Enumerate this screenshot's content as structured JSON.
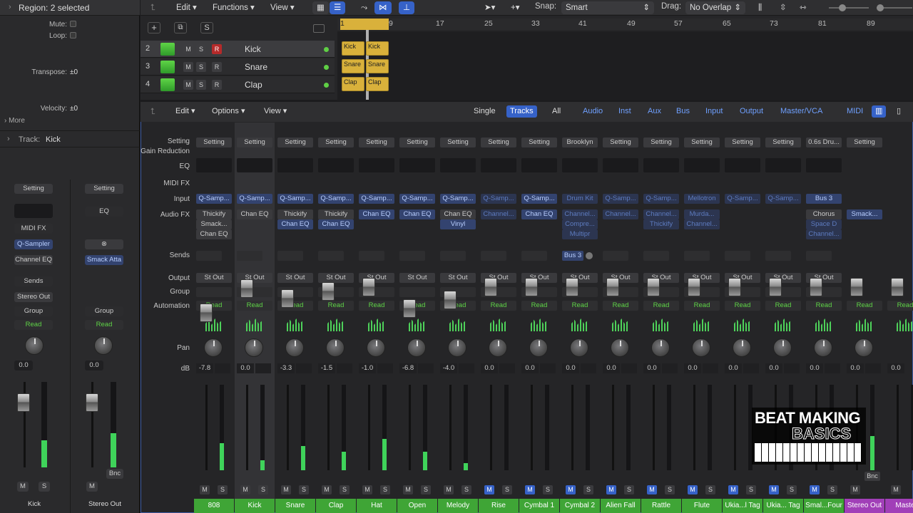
{
  "inspector": {
    "region_label": "Region: 2 selected",
    "rows": [
      {
        "label": "Mute:",
        "value": ""
      },
      {
        "label": "Loop:",
        "value": ""
      },
      {
        "label": "Transpose:",
        "value": "±0"
      },
      {
        "label": "Velocity:",
        "value": "±0"
      }
    ],
    "more": "More",
    "track_label": "Track:",
    "track_name": "Kick",
    "left": {
      "setting": "Setting",
      "midi_fx": "MIDI FX",
      "input": "Q-Sampler",
      "fx": "Channel EQ",
      "sends": "Sends",
      "output": "Stereo Out",
      "group": "Group",
      "auto": "Read",
      "db": "0.0",
      "m": "M",
      "s": "S",
      "name": "Kick"
    },
    "right": {
      "setting": "Setting",
      "eq": "EQ",
      "fx": "Smack Atta",
      "group": "Group",
      "auto": "Read",
      "db": "0.0",
      "m": "M",
      "bnc": "Bnc",
      "name": "Stereo Out"
    }
  },
  "toolbar": {
    "edit": "Edit",
    "functions": "Functions",
    "view": "View",
    "snap_label": "Snap:",
    "snap": "Smart",
    "drag_label": "Drag:",
    "drag": "No Overlap"
  },
  "ruler": [
    {
      "n": "1"
    },
    {
      "n": "9"
    },
    {
      "n": "17"
    },
    {
      "n": "25"
    },
    {
      "n": "33"
    },
    {
      "n": "41"
    },
    {
      "n": "49"
    },
    {
      "n": "57"
    },
    {
      "n": "65"
    },
    {
      "n": "73"
    },
    {
      "n": "81"
    },
    {
      "n": "89"
    }
  ],
  "tracks": [
    {
      "num": "2",
      "name": "Kick",
      "r": "R",
      "region": "Kick"
    },
    {
      "num": "3",
      "name": "Snare",
      "r": "R",
      "region": "Snare"
    },
    {
      "num": "4",
      "name": "Clap",
      "r": "R",
      "region": "Clap"
    }
  ],
  "track_buttons": {
    "m": "M",
    "s": "S"
  },
  "mixer_bar": {
    "edit": "Edit",
    "options": "Options",
    "view": "View",
    "single": "Single",
    "tracks": "Tracks",
    "all": "All",
    "audio": "Audio",
    "inst": "Inst",
    "aux": "Aux",
    "bus": "Bus",
    "input": "Input",
    "output": "Output",
    "master": "Master/VCA",
    "midi": "MIDI"
  },
  "row_labels": {
    "setting": "Setting",
    "gain": "Gain Reduction",
    "eq": "EQ",
    "midifx": "MIDI FX",
    "input": "Input",
    "audiofx": "Audio FX",
    "sends": "Sends",
    "output": "Output",
    "group": "Group",
    "automation": "Automation",
    "pan": "Pan",
    "db": "dB"
  },
  "strips": [
    {
      "name": "808",
      "setting": "Setting",
      "input": "Q-Samp...",
      "fx": [
        "Thickify",
        "Smack...",
        "Chan EQ"
      ],
      "out": "St Out",
      "auto": "Read",
      "db": "-7.8",
      "m": "M",
      "s": "S"
    },
    {
      "name": "Kick",
      "setting": "Setting",
      "input": "Q-Samp...",
      "fx": [
        "Chan EQ"
      ],
      "out": "St Out",
      "auto": "Read",
      "db": "0.0",
      "m": "M",
      "s": "S"
    },
    {
      "name": "Snare",
      "setting": "Setting",
      "input": "Q-Samp...",
      "fx": [
        "Thickify",
        "Chan EQ"
      ],
      "out": "St Out",
      "auto": "Read",
      "db": "-3.3",
      "m": "M",
      "s": "S"
    },
    {
      "name": "Clap",
      "setting": "Setting",
      "input": "Q-Samp...",
      "fx": [
        "Thickify",
        "Chan EQ"
      ],
      "out": "St Out",
      "auto": "Read",
      "db": "-1.5",
      "m": "M",
      "s": "S"
    },
    {
      "name": "Hat",
      "setting": "Setting",
      "input": "Q-Samp...",
      "fx": [
        "Chan EQ"
      ],
      "out": "St Out",
      "auto": "Read",
      "db": "-1.0",
      "m": "M",
      "s": "S"
    },
    {
      "name": "Open",
      "setting": "Setting",
      "input": "Q-Samp...",
      "fx": [
        "Chan EQ"
      ],
      "out": "St Out",
      "auto": "Read",
      "db": "-6.8",
      "m": "M",
      "s": "S"
    },
    {
      "name": "Melody",
      "setting": "Setting",
      "input": "Q-Samp...",
      "fx": [
        "Chan EQ",
        "Vinyl"
      ],
      "out": "St Out",
      "auto": "Read",
      "db": "-4.0",
      "m": "M",
      "s": "S"
    },
    {
      "name": "Rise",
      "setting": "Setting",
      "input": "Q-Samp...",
      "fx": [
        "Channel..."
      ],
      "out": "St Out",
      "auto": "Read",
      "db": "0.0",
      "m": "M",
      "s": "S"
    },
    {
      "name": "Cymbal 1",
      "setting": "Setting",
      "input": "Q-Samp...",
      "fx": [
        "Chan EQ"
      ],
      "out": "St Out",
      "auto": "Read",
      "db": "0.0",
      "m": "M",
      "s": "S"
    },
    {
      "name": "Cymbal 2",
      "setting": "Brooklyn",
      "input": "Drum Kit",
      "fx": [
        "Channel...",
        "Compre...",
        "Multipr"
      ],
      "send": "Bus 3",
      "out": "St Out",
      "auto": "Read",
      "db": "0.0",
      "m": "M",
      "s": "S"
    },
    {
      "name": "Alien Fall",
      "setting": "Setting",
      "input": "Q-Samp...",
      "fx": [
        "Channel..."
      ],
      "out": "St Out",
      "auto": "Read",
      "db": "0.0",
      "m": "M",
      "s": "S"
    },
    {
      "name": "Rattle",
      "setting": "Setting",
      "input": "Q-Samp...",
      "fx": [
        "Channel...",
        "Thickify"
      ],
      "out": "St Out",
      "auto": "Read",
      "db": "0.0",
      "m": "M",
      "s": "S"
    },
    {
      "name": "Flute",
      "setting": "Setting",
      "input": "Mellotron",
      "fx": [
        "Murda...",
        "Channel..."
      ],
      "out": "St Out",
      "auto": "Read",
      "db": "0.0",
      "m": "M",
      "s": "S"
    },
    {
      "name": "Ukia...l Tag",
      "setting": "Setting",
      "input": "Q-Samp...",
      "fx": [],
      "out": "St Out",
      "auto": "Read",
      "db": "0.0",
      "m": "M",
      "s": "S"
    },
    {
      "name": "Ukia... Tag",
      "setting": "Setting",
      "input": "Q-Samp...",
      "fx": [],
      "out": "St Out",
      "auto": "Read",
      "db": "0.0",
      "m": "M",
      "s": "S"
    },
    {
      "name": "Smal...Four",
      "setting": "0.6s Dru...",
      "input": "Bus 3",
      "fx": [
        "Chorus",
        "Space D",
        "Channel..."
      ],
      "out": "St Out",
      "auto": "Read",
      "db": "0.0",
      "m": "M",
      "s": "S"
    },
    {
      "name": "Stereo Out",
      "setting": "Setting",
      "input": "",
      "fx": [
        "Smack..."
      ],
      "out": "",
      "auto": "Read",
      "db": "0.0",
      "m": "M",
      "s": ""
    },
    {
      "name": "Maste",
      "setting": "",
      "input": "",
      "fx": [],
      "out": "",
      "auto": "Read",
      "db": "0.0",
      "m": "M",
      "s": ""
    }
  ],
  "logo": {
    "line1": "BEAT MAKING",
    "line2": "BASICS"
  },
  "bnc": "Bnc"
}
